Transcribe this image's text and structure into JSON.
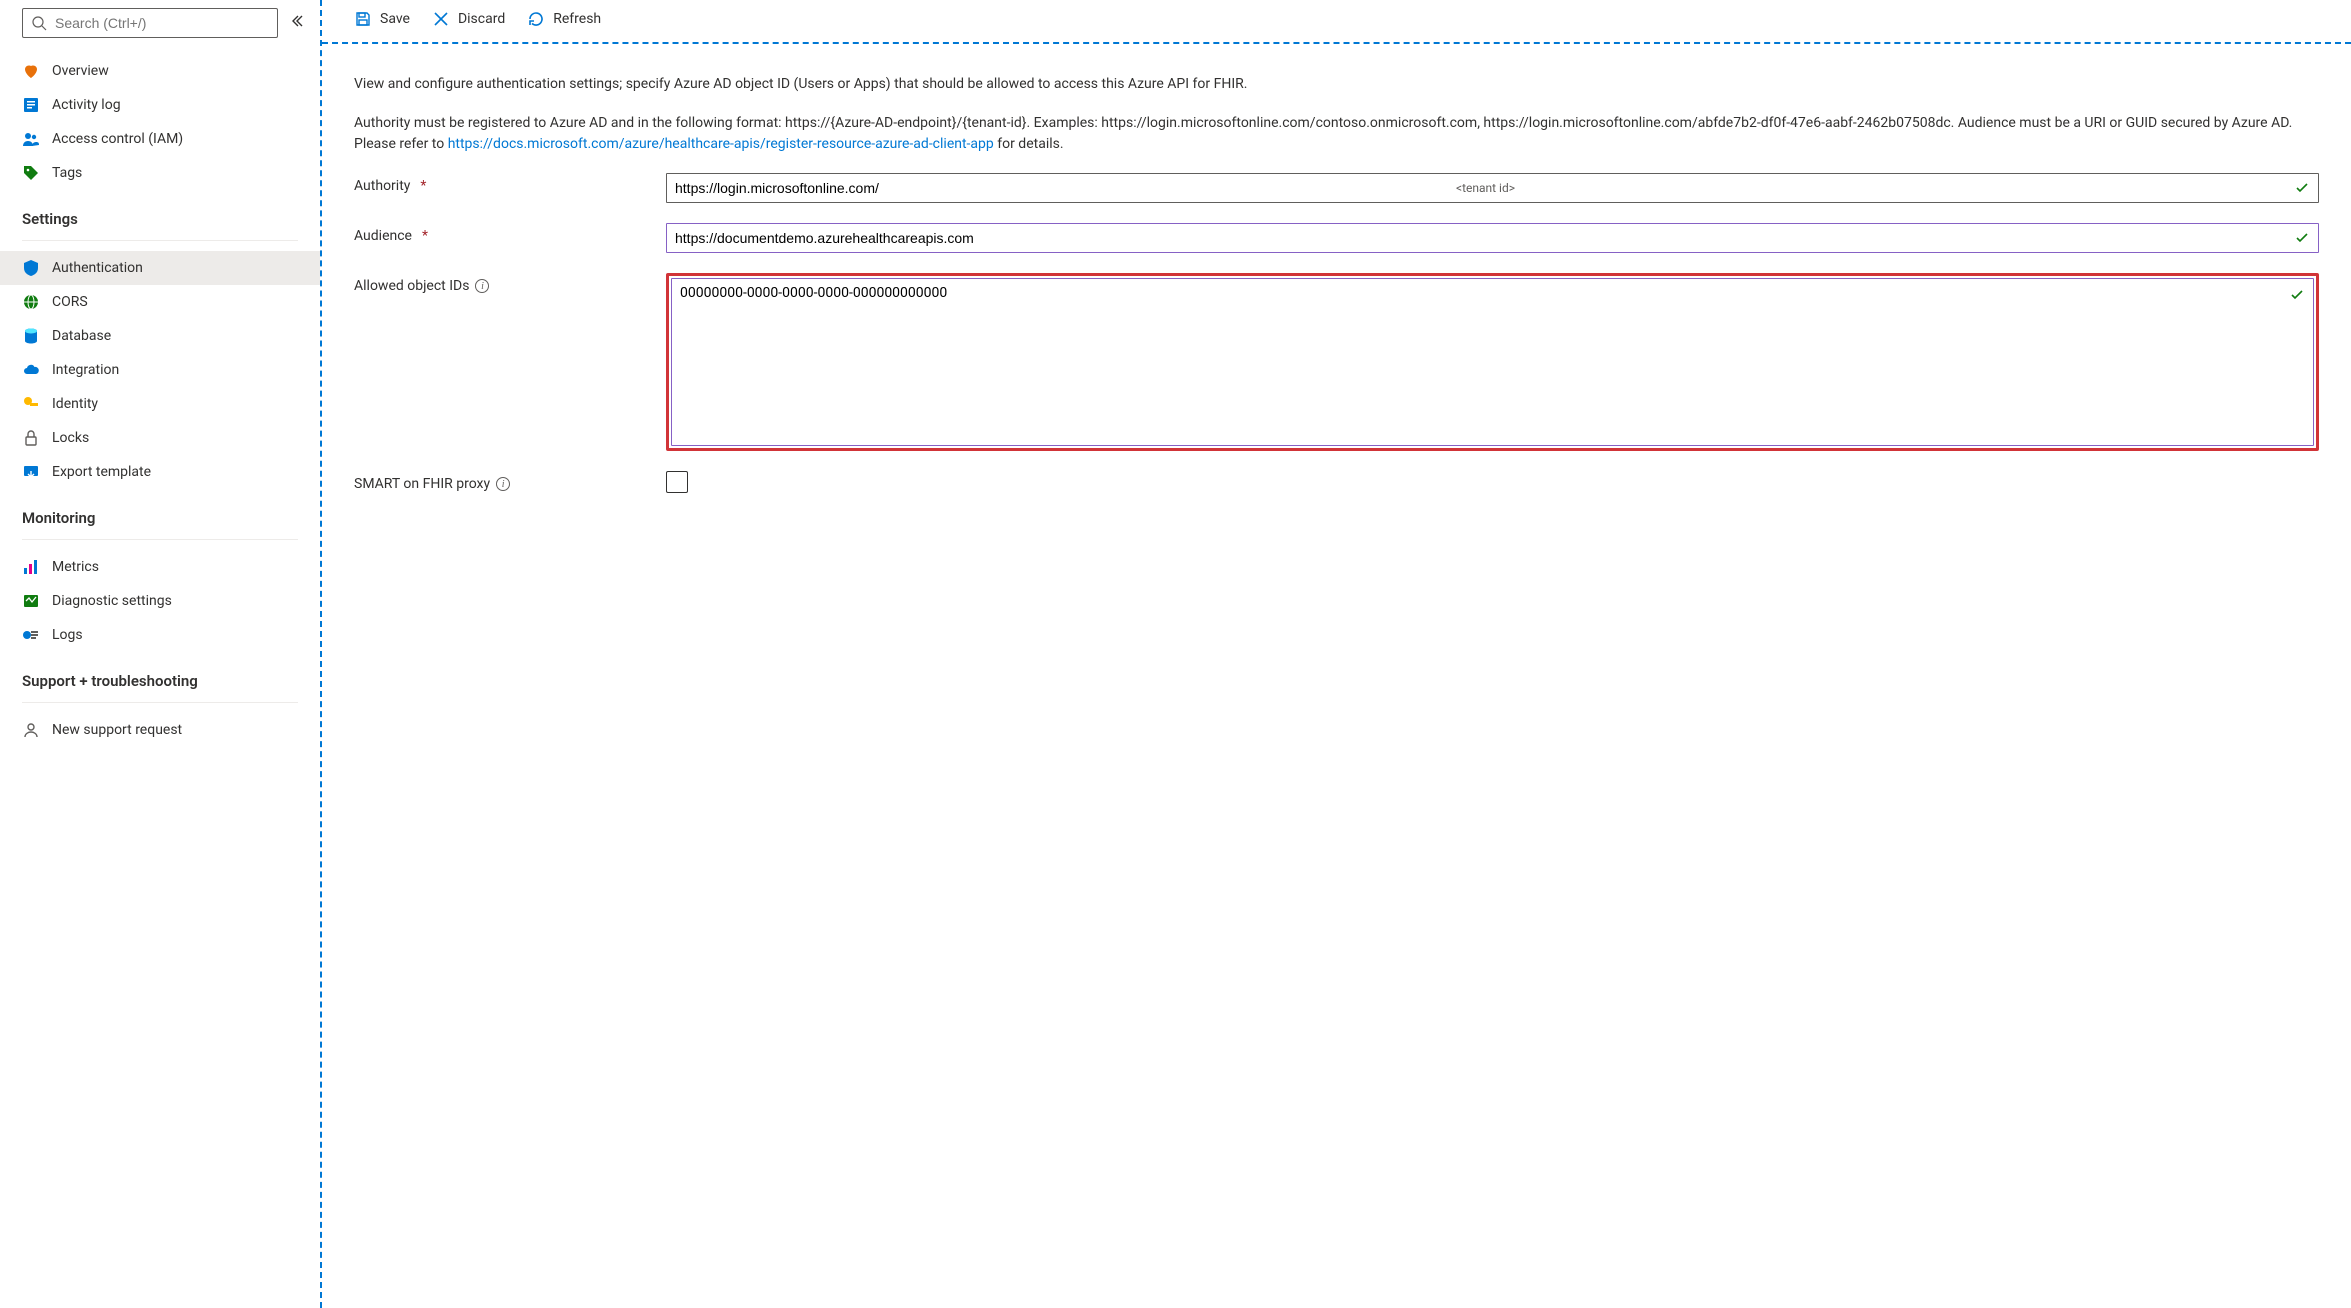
{
  "search": {
    "placeholder": "Search (Ctrl+/)"
  },
  "nav": {
    "top": [
      {
        "label": "Overview",
        "icon": "heart"
      },
      {
        "label": "Activity log",
        "icon": "log"
      },
      {
        "label": "Access control (IAM)",
        "icon": "people"
      },
      {
        "label": "Tags",
        "icon": "tag"
      }
    ],
    "settings_heading": "Settings",
    "settings": [
      {
        "label": "Authentication",
        "icon": "shield",
        "active": true
      },
      {
        "label": "CORS",
        "icon": "globe"
      },
      {
        "label": "Database",
        "icon": "db"
      },
      {
        "label": "Integration",
        "icon": "cloud"
      },
      {
        "label": "Identity",
        "icon": "key"
      },
      {
        "label": "Locks",
        "icon": "lock"
      },
      {
        "label": "Export template",
        "icon": "export"
      }
    ],
    "monitoring_heading": "Monitoring",
    "monitoring": [
      {
        "label": "Metrics",
        "icon": "chart"
      },
      {
        "label": "Diagnostic settings",
        "icon": "diag"
      },
      {
        "label": "Logs",
        "icon": "logs"
      }
    ],
    "support_heading": "Support + troubleshooting",
    "support": [
      {
        "label": "New support request",
        "icon": "person"
      }
    ]
  },
  "toolbar": {
    "save": "Save",
    "discard": "Discard",
    "refresh": "Refresh"
  },
  "content": {
    "desc1": "View and configure authentication settings; specify Azure AD object ID (Users or Apps) that should be allowed to access this Azure API for FHIR.",
    "desc2a": "Authority must be registered to Azure AD and in the following format: https://{Azure-AD-endpoint}/{tenant-id}. Examples: https://login.microsoftonline.com/contoso.onmicrosoft.com, https://login.microsoftonline.com/abfde7b2-df0f-47e6-aabf-2462b07508dc. Audience must be a URI or GUID secured by Azure AD. Please refer to ",
    "desc2link": "https://docs.microsoft.com/azure/healthcare-apis/register-resource-azure-ad-client-app",
    "desc2b": " for details.",
    "authority_label": "Authority",
    "authority_value": "https://login.microsoftonline.com/",
    "authority_hint": "<tenant id>",
    "audience_label": "Audience",
    "audience_value": "https://documentdemo.azurehealthcareapis.com",
    "allowed_label": "Allowed object IDs",
    "allowed_value": "00000000-0000-0000-0000-000000000000",
    "smart_label": "SMART on FHIR proxy"
  }
}
